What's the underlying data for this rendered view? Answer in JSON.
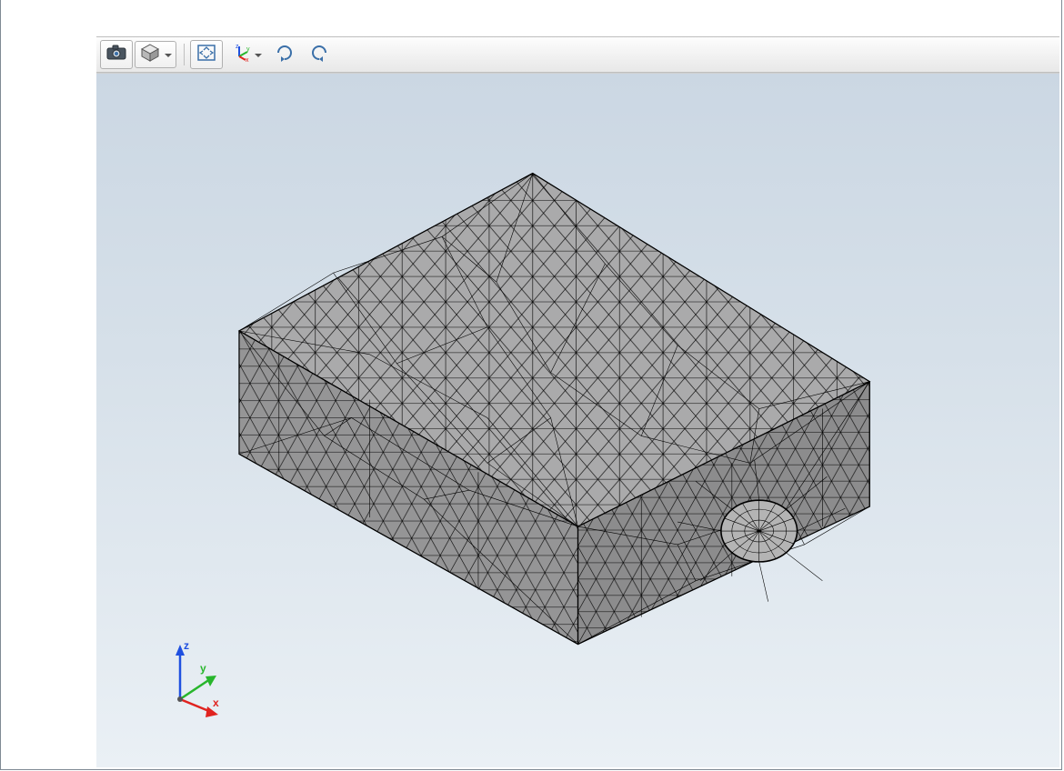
{
  "toolbar": {
    "buttons": [
      {
        "name": "screenshot-button",
        "icon": "camera-icon",
        "dropdown": false
      },
      {
        "name": "view-cube-button",
        "icon": "cube-icon",
        "dropdown": true
      },
      {
        "name": "zoom-extents-button",
        "icon": "fit-extents-icon",
        "dropdown": false,
        "sep_before": true
      },
      {
        "name": "axis-orient-button",
        "icon": "xyz-axes-icon",
        "dropdown": true
      },
      {
        "name": "rotate-cw-button",
        "icon": "rotate-cw-icon",
        "dropdown": false
      },
      {
        "name": "rotate-ccw-button",
        "icon": "rotate-ccw-icon",
        "dropdown": false
      }
    ]
  },
  "viewport": {
    "background_gradient_top": "#cbd7e3",
    "background_gradient_bottom": "#eaf0f5",
    "mesh_color": "#99999a",
    "mesh_edge_color": "#000000",
    "object_description": "Rectangular solid block with triangular surface mesh and a small hemispherical protrusion on the front-right face, isometric view"
  },
  "axis_triad": {
    "x": {
      "label": "x",
      "color": "#e0231f"
    },
    "y": {
      "label": "y",
      "color": "#28b62c"
    },
    "z": {
      "label": "z",
      "color": "#1f50e0"
    }
  }
}
